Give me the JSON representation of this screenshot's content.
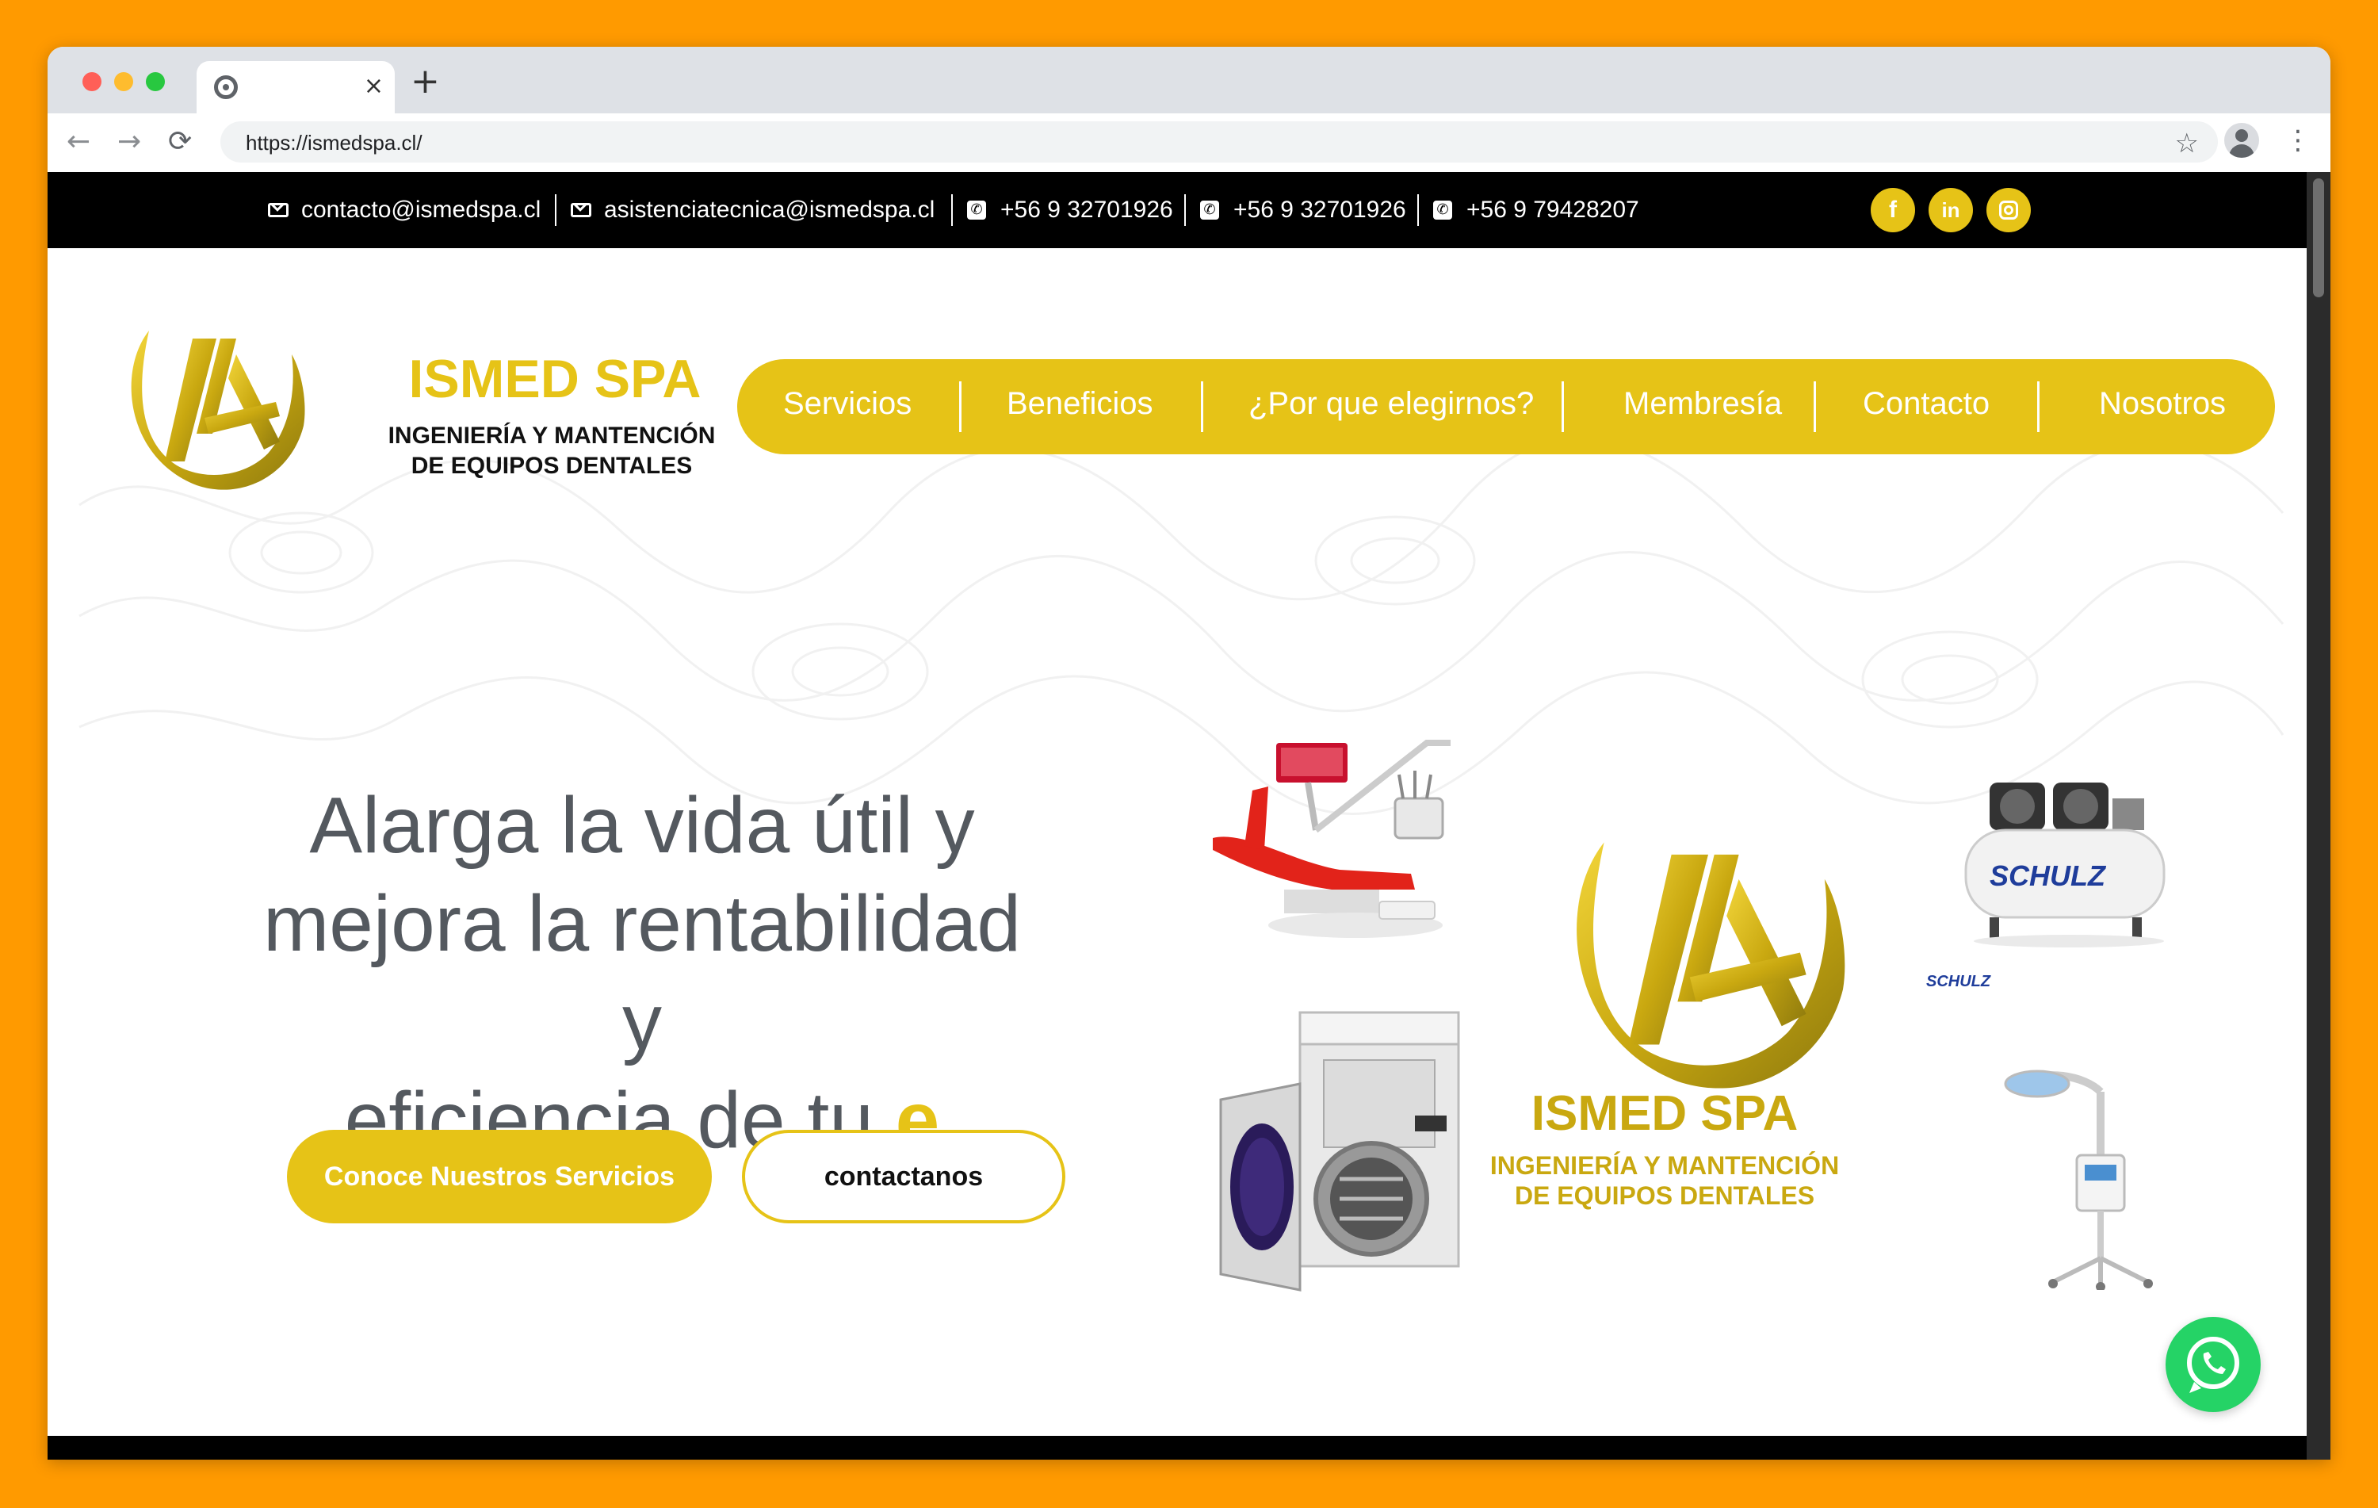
{
  "browser": {
    "url": "https://ismedspa.cl/",
    "tab_close": "×",
    "new_tab": "+",
    "back": "←",
    "forward": "→",
    "reload": "⟳",
    "star": "☆",
    "menu": "⋮"
  },
  "topbar": {
    "email1": "contacto@ismedspa.cl",
    "email2": "asistenciatecnica@ismedspa.cl",
    "phone1": "+56 9 32701926",
    "phone2": "+56 9 32701926",
    "phone3": "+56 9 79428207",
    "phone_glyph": "✆",
    "social": {
      "facebook": "f",
      "linkedin": "in"
    }
  },
  "brand": {
    "name": "ISMED SPA",
    "tagline_line1": "INGENIERÍA Y MANTENCIÓN",
    "tagline_line2": "DE EQUIPOS DENTALES"
  },
  "nav": {
    "items": [
      "Servicios",
      "Beneficios",
      "¿Por que elegirnos?",
      "Membresía",
      "Contacto",
      "Nosotros"
    ]
  },
  "hero": {
    "line1": "Alarga la vida útil y",
    "line2": "mejora la rentabilidad y",
    "line3_prefix": "eficiencia de tu ",
    "line3_highlight": "e",
    "btn_primary": "Conoce Nuestros Servicios",
    "btn_secondary": "contactanos"
  },
  "showcase": {
    "brand_name": "ISMED SPA",
    "tagline_line1": "INGENIERÍA Y MANTENCIÓN",
    "tagline_line2": "DE EQUIPOS DENTALES",
    "compressor_brand": "SCHULZ",
    "compressor_mini": "SCHULZ"
  },
  "colors": {
    "accent": "#E6C317",
    "gold_dark": "#C9A810",
    "frame": "#FF9A00",
    "topbar": "#000000",
    "hero_text": "#54595F",
    "whatsapp": "#25D366"
  },
  "icons": [
    "mail-icon",
    "phone-icon",
    "facebook-icon",
    "linkedin-icon",
    "instagram-icon",
    "whatsapp-icon"
  ]
}
